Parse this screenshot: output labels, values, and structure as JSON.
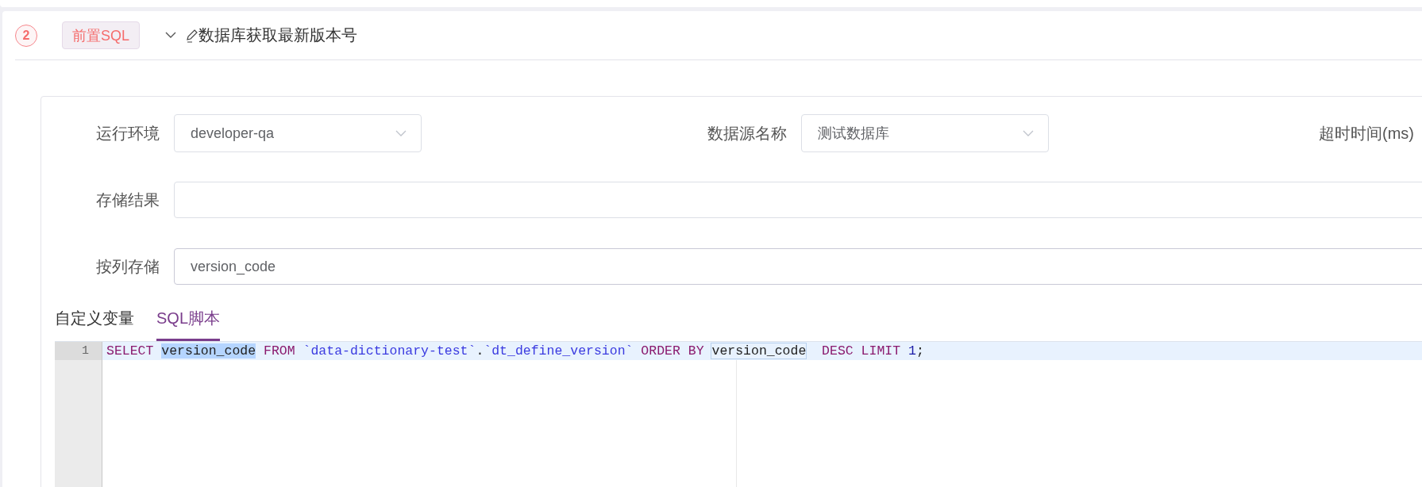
{
  "step": {
    "number": "2",
    "tag": "前置SQL",
    "expanded": true,
    "title": "数据库获取最新版本号"
  },
  "form": {
    "rows": [
      [
        {
          "label": "运行环境",
          "kind": "select",
          "value": "developer-qa"
        },
        {
          "label": "数据源名称",
          "kind": "select",
          "value": "测试数据库"
        },
        {
          "label": "超时时间(ms)",
          "kind": "label"
        }
      ],
      [
        {
          "label": "存储结果",
          "kind": "text"
        }
      ],
      [
        {
          "label": "按列存储",
          "kind": "text",
          "value": "version_code"
        }
      ]
    ]
  },
  "tabs": [
    {
      "label": "自定义变量",
      "selected": false
    },
    {
      "label": "SQL脚本",
      "selected": true
    }
  ],
  "editor": {
    "lines": [
      {
        "number": "1",
        "active": true,
        "tokens": [
          {
            "text": "SELECT ",
            "kind": "keyword"
          },
          {
            "text": "version_code",
            "kind": "selected"
          },
          {
            "text": " FROM ",
            "kind": "keyword"
          },
          {
            "text": "`data-dictionary-test`",
            "kind": "quoted"
          },
          {
            "text": ".",
            "kind": "plain"
          },
          {
            "text": "`dt_define_version`",
            "kind": "quoted"
          },
          {
            "text": " ORDER BY ",
            "kind": "keyword"
          },
          {
            "text": "version_code",
            "kind": "match"
          },
          {
            "text": "  DESC LIMIT ",
            "kind": "keyword"
          },
          {
            "text": "1",
            "kind": "number"
          },
          {
            "text": ";",
            "kind": "plain"
          }
        ]
      }
    ]
  }
}
